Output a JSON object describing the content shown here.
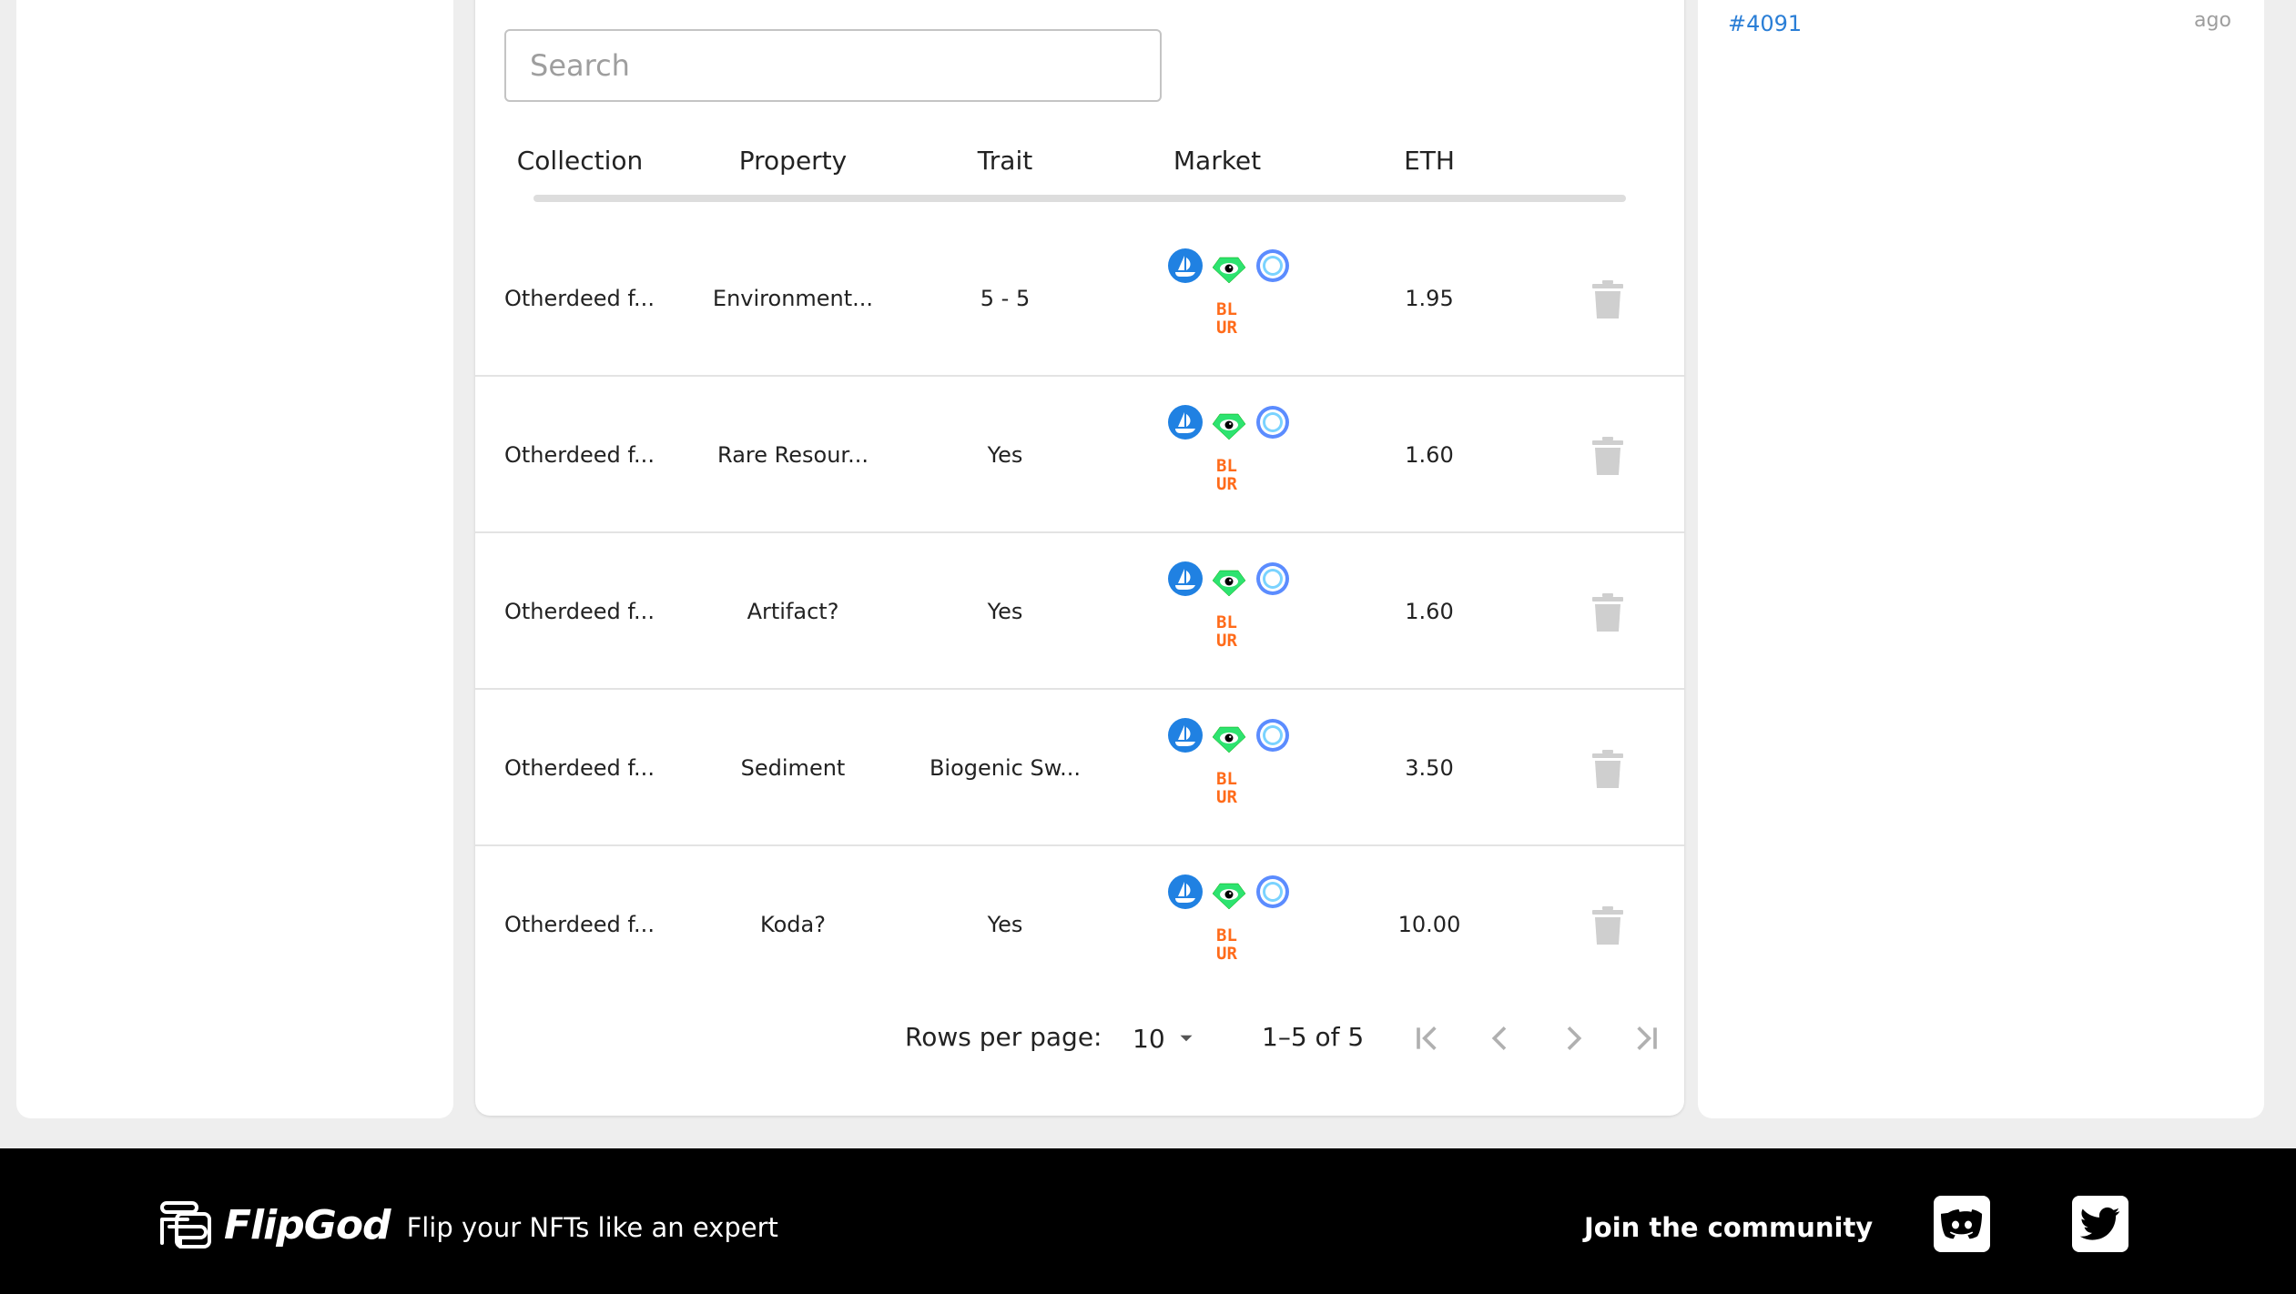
{
  "search": {
    "placeholder": "Search"
  },
  "table": {
    "columns": [
      "Collection",
      "Property",
      "Trait",
      "Market",
      "ETH"
    ],
    "rows": [
      {
        "collection": "Otherdeed f...",
        "property": "Environment...",
        "trait": "5 - 5",
        "eth": "1.95"
      },
      {
        "collection": "Otherdeed f...",
        "property": "Rare Resour...",
        "trait": "Yes",
        "eth": "1.60"
      },
      {
        "collection": "Otherdeed f...",
        "property": "Artifact?",
        "trait": "Yes",
        "eth": "1.60"
      },
      {
        "collection": "Otherdeed f...",
        "property": "Sediment",
        "trait": "Biogenic Sw...",
        "eth": "3.50"
      },
      {
        "collection": "Otherdeed f...",
        "property": "Koda?",
        "trait": "Yes",
        "eth": "10.00"
      }
    ],
    "market_icons": [
      "opensea-icon",
      "looksrare-icon",
      "x2y2-icon",
      "blur-icon"
    ],
    "blur_logo_text": [
      "BL",
      "UR"
    ]
  },
  "pagination": {
    "rows_per_page_label": "Rows per page:",
    "rows_per_page_value": "10",
    "range_text": "1–5 of 5"
  },
  "sidebar_right": {
    "order_id": "#4091",
    "time_ago": "ago"
  },
  "footer": {
    "brand_name": "FlipGod",
    "tagline": "Flip your NFTs like an expert",
    "join_label": "Join the community"
  },
  "colors": {
    "accent_link": "#2a7ed6",
    "opensea": "#2081e2",
    "looksrare": "#2de370",
    "x2y2": "#5b8cff",
    "blur": "#ff6b1a",
    "trash": "#cfcfcf"
  }
}
